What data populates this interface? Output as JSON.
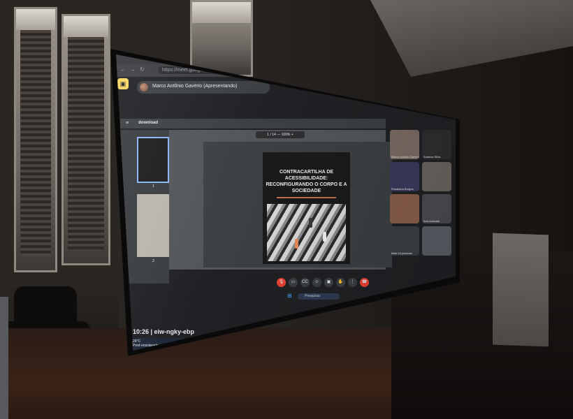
{
  "browser": {
    "url": "https://meet.google.com/eiw-ngky-ebp",
    "back_icon": "arrow-left-icon",
    "forward_icon": "arrow-right-icon",
    "reload_icon": "reload-icon"
  },
  "meet": {
    "presenter_name": "Marco Antônio Gavério (Apresentando)",
    "doc_title": "download",
    "page_control": "1 / 14  —  100%  +",
    "meeting_time": "10:26  |  eiw-ngky-ebp"
  },
  "slide": {
    "title": "CONTRACARTILHA DE ACESSIBILIDADE: RECONFIGURANDO O CORPO E A SOCIEDADE"
  },
  "thumbnails": [
    {
      "number": "1"
    },
    {
      "number": "2"
    }
  ],
  "participants": [
    {
      "label": "Marco Antônio Gavério",
      "color": "#7a6b62"
    },
    {
      "label": "Ananias Silva",
      "color": "#2d2e30"
    },
    {
      "label": "Rosaliana Burgos",
      "color": "#3c3a5c"
    },
    {
      "label": "",
      "color": "#6b6560"
    },
    {
      "label": "",
      "color": "#8a5e4a"
    },
    {
      "label": "Ana Andrade",
      "color": "#4a4c50"
    },
    {
      "label": "Mais 15 pessoas",
      "color": "#3c4043"
    },
    {
      "label": "",
      "color": "#5a5f66"
    }
  ],
  "controls": [
    {
      "icon": "mic-off-icon",
      "red": true
    },
    {
      "icon": "camera-icon",
      "red": false
    },
    {
      "icon": "captions-icon",
      "red": false
    },
    {
      "icon": "emoji-icon",
      "red": false
    },
    {
      "icon": "present-icon",
      "red": false
    },
    {
      "icon": "raise-hand-icon",
      "red": false
    },
    {
      "icon": "more-icon",
      "red": false
    },
    {
      "icon": "end-call-icon",
      "red": true
    }
  ],
  "taskbar": {
    "weather_temp": "26°C",
    "weather_desc": "Pred ensolarado",
    "search_placeholder": "Pesquisar"
  },
  "colors": {
    "meet_bg": "#202124",
    "accent_yellow": "#fdd663",
    "end_call_red": "#ea4335",
    "selected_blue": "#8ab4f8"
  }
}
